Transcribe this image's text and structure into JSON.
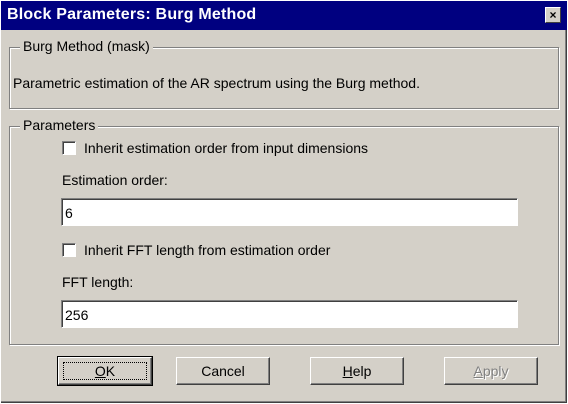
{
  "window": {
    "title": "Block Parameters: Burg Method",
    "close_glyph": "×"
  },
  "mask_group": {
    "legend": "Burg Method (mask)",
    "description": "Parametric estimation of the AR spectrum using the Burg method."
  },
  "parameters": {
    "legend": "Parameters",
    "inherit_order_label": "Inherit estimation order from input dimensions",
    "inherit_order_checked": false,
    "estimation_order_label": "Estimation order:",
    "estimation_order_value": "6",
    "inherit_fft_label": "Inherit FFT length from estimation order",
    "inherit_fft_checked": false,
    "fft_length_label": "FFT length:",
    "fft_length_value": "256"
  },
  "buttons": {
    "ok": {
      "mnemonic": "O",
      "rest": "K"
    },
    "cancel": "Cancel",
    "help": {
      "mnemonic": "H",
      "rest": "elp"
    },
    "apply": {
      "mnemonic": "A",
      "rest": "pply"
    }
  },
  "colors": {
    "titlebar": "#000080",
    "face": "#d4d0c8",
    "disabled_text": "#808080"
  }
}
